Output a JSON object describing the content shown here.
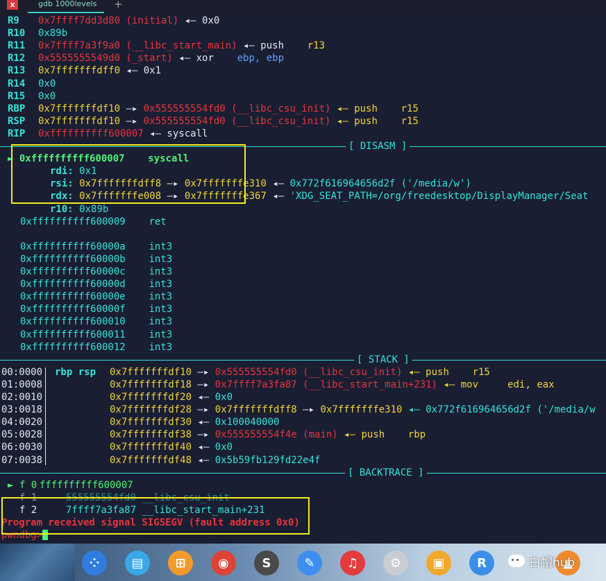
{
  "tab": {
    "title": "gdb 1000levels",
    "close": "x",
    "add": "+"
  },
  "registers": [
    {
      "name": "R9",
      "val": "0x7ffff7dd3d80 (initial)",
      "val_color": "red",
      "rest": " ◂— 0x0",
      "extra": "",
      "extra2": ""
    },
    {
      "name": "R10",
      "val": "0x89b",
      "val_color": "cyan",
      "rest": "",
      "extra": "",
      "extra2": ""
    },
    {
      "name": "R11",
      "val": "0x7ffff7a3f9a0 (__libc_start_main)",
      "val_color": "red",
      "rest": " ◂— push",
      "extra": "    r13",
      "extra2": ""
    },
    {
      "name": "R12",
      "val": "0x5555555549d0 (_start)",
      "val_color": "red",
      "rest": " ◂— xor",
      "extra": "    ebp, ebp",
      "extra2": ""
    },
    {
      "name": "R13",
      "val": "0x7fffffffdff0",
      "val_color": "yellow",
      "rest": " ◂— 0x1",
      "extra": "",
      "extra2": ""
    },
    {
      "name": "R14",
      "val": "0x0",
      "val_color": "cyan",
      "rest": "",
      "extra": "",
      "extra2": ""
    },
    {
      "name": "R15",
      "val": "0x0",
      "val_color": "cyan",
      "rest": "",
      "extra": "",
      "extra2": ""
    },
    {
      "name": "RBP",
      "val": "0x7fffffffdf10",
      "val_color": "yellow",
      "rest": " —▸ ",
      "extra": "0x555555554fd0 (__libc_csu_init)",
      "extra2": " ◂— push    r15"
    },
    {
      "name": "RSP",
      "val": "0x7fffffffdf10",
      "val_color": "yellow",
      "rest": " —▸ ",
      "extra": "0x555555554fd0 (__libc_csu_init)",
      "extra2": " ◂— push    r15"
    },
    {
      "name": "RIP",
      "val": "0xffffffffff600007",
      "val_color": "red",
      "rest": " ◂— syscall",
      "extra": "",
      "extra2": ""
    }
  ],
  "sections": {
    "disasm": "[ DISASM ]",
    "stack": "[ STACK ]",
    "backtrace": "[ BACKTRACE ]"
  },
  "disasm": {
    "current": {
      "marker": "►",
      "addr": "0xffffffffff600007",
      "op": "syscall"
    },
    "args": [
      {
        "reg": "rdi:",
        "v1": "0x1",
        "a": "",
        "v2": "",
        "b": "",
        "v3": ""
      },
      {
        "reg": "rsi:",
        "v1": "0x7fffffffdff8",
        "a": " —▸ ",
        "v2": "0x7fffffffe310",
        "b": " ◂— ",
        "v3": "0x772f616964656d2f ('/media/w')"
      },
      {
        "reg": "rdx:",
        "v1": "0x7fffffffe008",
        "a": " —▸ ",
        "v2": "0x7fffffffe367",
        "b": " ◂— ",
        "v3": "'XDG_SEAT_PATH=/org/freedesktop/DisplayManager/Seat"
      },
      {
        "reg": "r10:",
        "v1": "0x89b",
        "a": "",
        "v2": "",
        "b": "",
        "v3": ""
      }
    ],
    "lines": [
      {
        "addr": "0xffffffffff600009",
        "op": "ret"
      },
      {
        "addr": "",
        "op": ""
      },
      {
        "addr": "0xffffffffff60000a",
        "op": "int3"
      },
      {
        "addr": "0xffffffffff60000b",
        "op": "int3"
      },
      {
        "addr": "0xffffffffff60000c",
        "op": "int3"
      },
      {
        "addr": "0xffffffffff60000d",
        "op": "int3"
      },
      {
        "addr": "0xffffffffff60000e",
        "op": "int3"
      },
      {
        "addr": "0xffffffffff60000f",
        "op": "int3"
      },
      {
        "addr": "0xffffffffff600010",
        "op": "int3"
      },
      {
        "addr": "0xffffffffff600011",
        "op": "int3"
      },
      {
        "addr": "0xffffffffff600012",
        "op": "int3"
      }
    ]
  },
  "stack": [
    {
      "idx": "00:0000",
      "regs": "rbp rsp",
      "addr": "0x7fffffffdf10",
      "arrow": " —▸ ",
      "v1": "0x555555554fd0 (__libc_csu_init)",
      "v1c": "red",
      "tail": " ◂— push    r15",
      "v2": "",
      "tail2": ""
    },
    {
      "idx": "01:0008",
      "regs": "",
      "addr": "0x7fffffffdf18",
      "arrow": " —▸ ",
      "v1": "0x7ffff7a3fa87 (__libc_start_main+231)",
      "v1c": "red",
      "tail": " ◂— mov     edi, eax",
      "v2": "",
      "tail2": ""
    },
    {
      "idx": "02:0010",
      "regs": "",
      "addr": "0x7fffffffdf20",
      "arrow": " ◂— ",
      "v1": "0x0",
      "v1c": "cyan",
      "tail": "",
      "v2": "",
      "tail2": ""
    },
    {
      "idx": "03:0018",
      "regs": "",
      "addr": "0x7fffffffdf28",
      "arrow": " —▸ ",
      "v1": "0x7fffffffdff8",
      "v1c": "yellow",
      "tail": " —▸ ",
      "v2": "0x7fffffffe310",
      "tail2": " ◂— 0x772f616964656d2f ('/media/w"
    },
    {
      "idx": "04:0020",
      "regs": "",
      "addr": "0x7fffffffdf30",
      "arrow": " ◂— ",
      "v1": "0x100040000",
      "v1c": "cyan",
      "tail": "",
      "v2": "",
      "tail2": ""
    },
    {
      "idx": "05:0028",
      "regs": "",
      "addr": "0x7fffffffdf38",
      "arrow": " —▸ ",
      "v1": "0x555555554f4e (main)",
      "v1c": "red",
      "tail": " ◂— push    rbp",
      "v2": "",
      "tail2": ""
    },
    {
      "idx": "06:0030",
      "regs": "",
      "addr": "0x7fffffffdf40",
      "arrow": " ◂— ",
      "v1": "0x0",
      "v1c": "cyan",
      "tail": "",
      "v2": "",
      "tail2": ""
    },
    {
      "idx": "07:0038",
      "regs": "",
      "addr": "0x7fffffffdf48",
      "arrow": " ◂— ",
      "v1": "0x5b59fb129fd22e4f",
      "v1c": "cyan",
      "tail": "",
      "v2": "",
      "tail2": ""
    }
  ],
  "backtrace": [
    {
      "marker": "►",
      "frame": "f 0",
      "addr": "ffffffffff600007",
      "sym": ""
    },
    {
      "marker": " ",
      "frame": "f 1",
      "addr": "555555554fd0",
      "sym": "__libc_csu_init"
    },
    {
      "marker": " ",
      "frame": "f 2",
      "addr": "7ffff7a3fa87",
      "sym": "__libc_start_main+231"
    }
  ],
  "signal": "Program received signal SIGSEGV (fault address 0x0)",
  "prompt": "pwndbg>",
  "taskbar": {
    "icons": [
      {
        "name": "launcher-icon",
        "glyph": "⁘",
        "bg": "#2f7de0"
      },
      {
        "name": "file-manager-icon",
        "glyph": "▤",
        "bg": "#38a8e8"
      },
      {
        "name": "app-store-icon",
        "glyph": "⊞",
        "bg": "#f39a2d"
      },
      {
        "name": "chrome-icon",
        "glyph": "◉",
        "bg": "#db4437"
      },
      {
        "name": "sublime-text-icon",
        "glyph": "S",
        "bg": "#4a4a4a"
      },
      {
        "name": "editor-icon",
        "glyph": "✎",
        "bg": "#3d8ef0"
      },
      {
        "name": "music-icon",
        "glyph": "♫",
        "bg": "#e23c3c"
      },
      {
        "name": "settings-icon",
        "glyph": "⚙",
        "bg": "#c9ccd2"
      },
      {
        "name": "workspace-icon",
        "glyph": "▣",
        "bg": "#f0a92d"
      },
      {
        "name": "r-app-icon",
        "glyph": "R",
        "bg": "#3a8ee6"
      }
    ],
    "watermark": "白帽hub"
  }
}
